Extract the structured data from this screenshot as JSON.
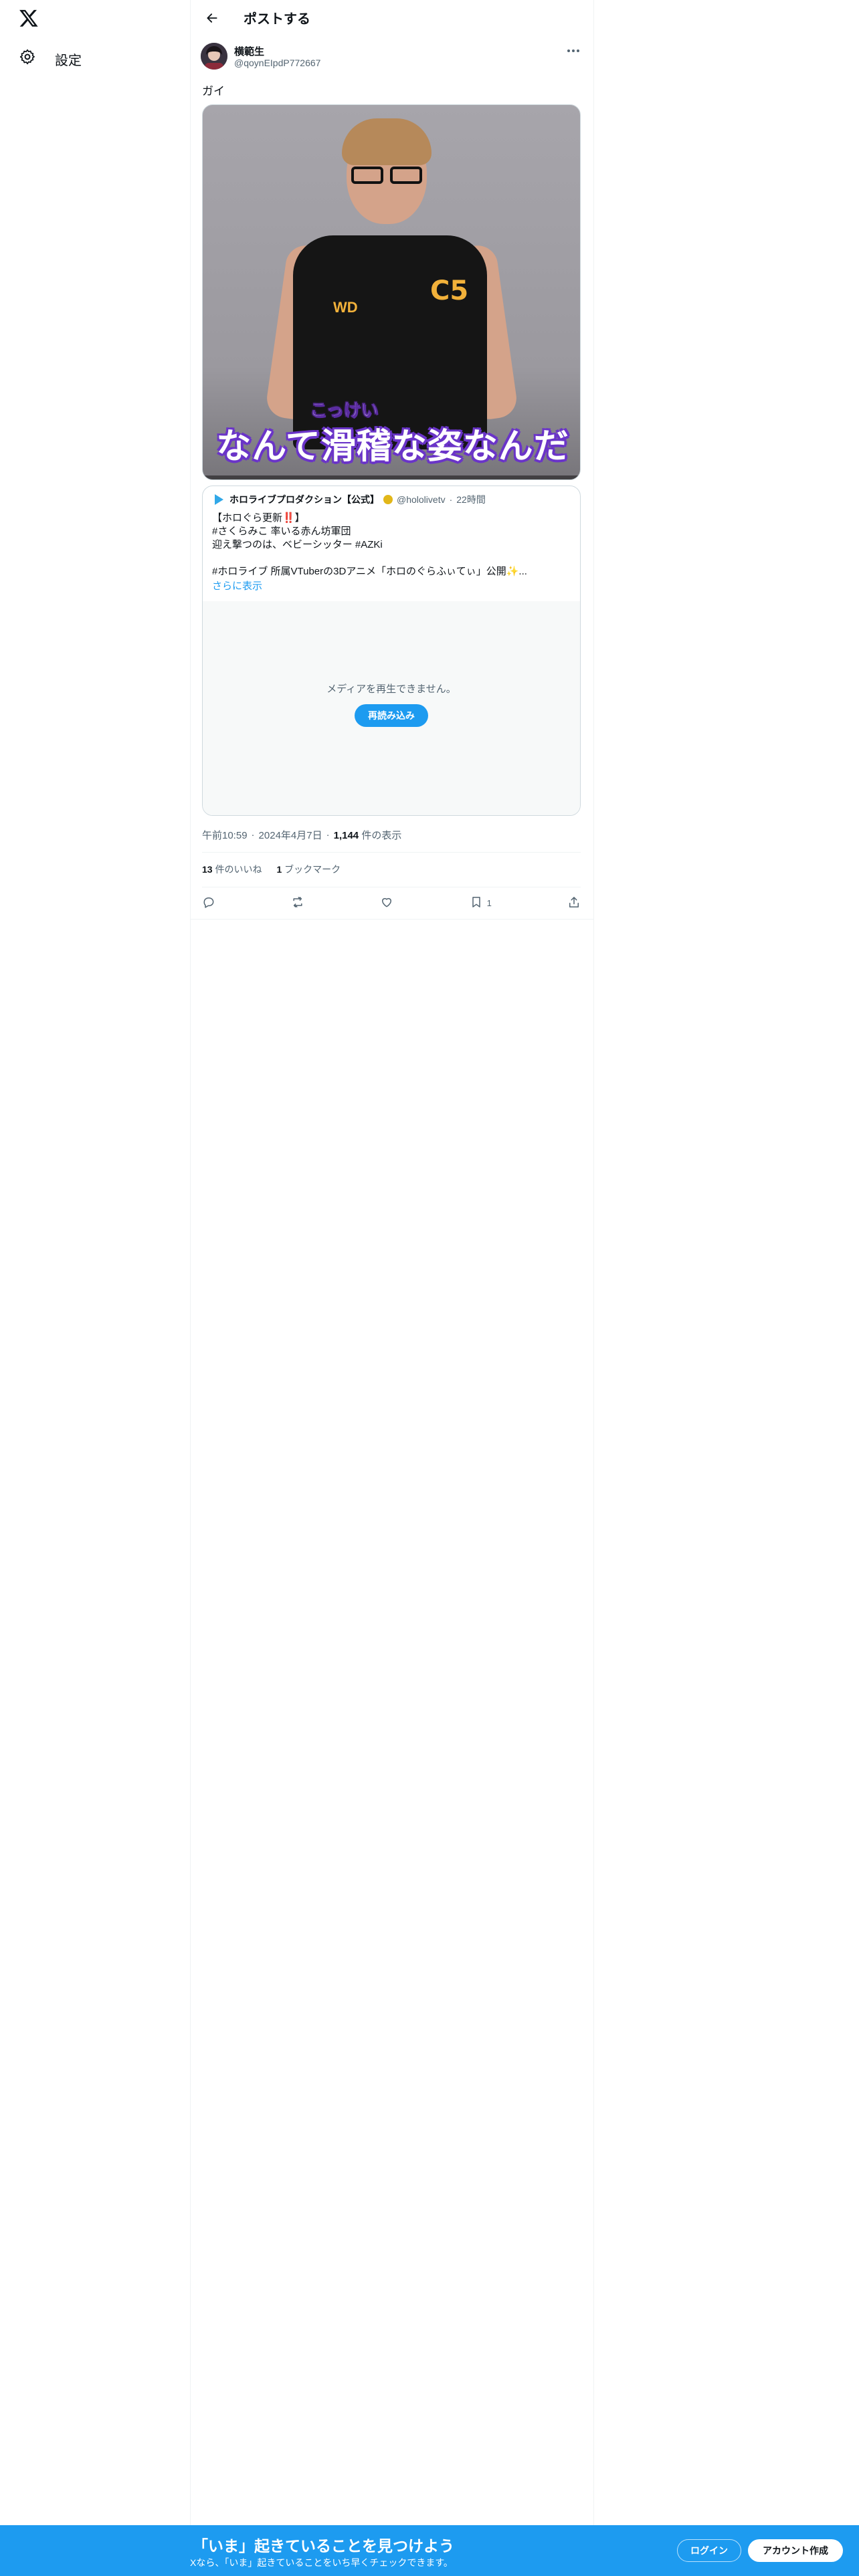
{
  "nav": {
    "settings_label": "設定"
  },
  "header": {
    "title": "ポストする"
  },
  "post": {
    "author_name": "横範生",
    "author_handle": "@qoynEIpdP772667",
    "text": "ガイ",
    "video": {
      "caption_small": "こっけい",
      "caption_big": "なんて滑稽な姿なんだ"
    },
    "quote": {
      "name": "ホロライブプロダクション【公式】",
      "handle": "@hololivetv",
      "separator": "·",
      "time": "22時間",
      "text": "【ホロぐら更新‼️】\n#さくらみこ 率いる赤ん坊軍団\n迎え撃つのは、ベビーシッター #AZKi\n\n#ホロライブ 所属VTuberの3Dアニメ「ホロのぐらふぃてぃ」公開✨...",
      "show_more": "さらに表示",
      "media_message": "メディアを再生できません。",
      "reload_label": "再読み込み"
    },
    "time": "午前10:59",
    "dot1": "·",
    "date": "2024年4月7日",
    "dot2": "·",
    "views_count": "1,144",
    "views_label": "件の表示",
    "likes_count": "13",
    "likes_label": "件のいいね",
    "bookmarks_count": "1",
    "bookmarks_label": "ブックマーク",
    "actions": {
      "bookmark_count": "1"
    }
  },
  "banner": {
    "title": "「いま」起きていることを見つけよう",
    "subtitle": "Xなら、「いま」起きていることをいち早くチェックできます。",
    "login_label": "ログイン",
    "signup_label": "アカウント作成"
  },
  "colors": {
    "accent": "#1d9bf0",
    "text": "#0f1419",
    "muted": "#536471"
  }
}
